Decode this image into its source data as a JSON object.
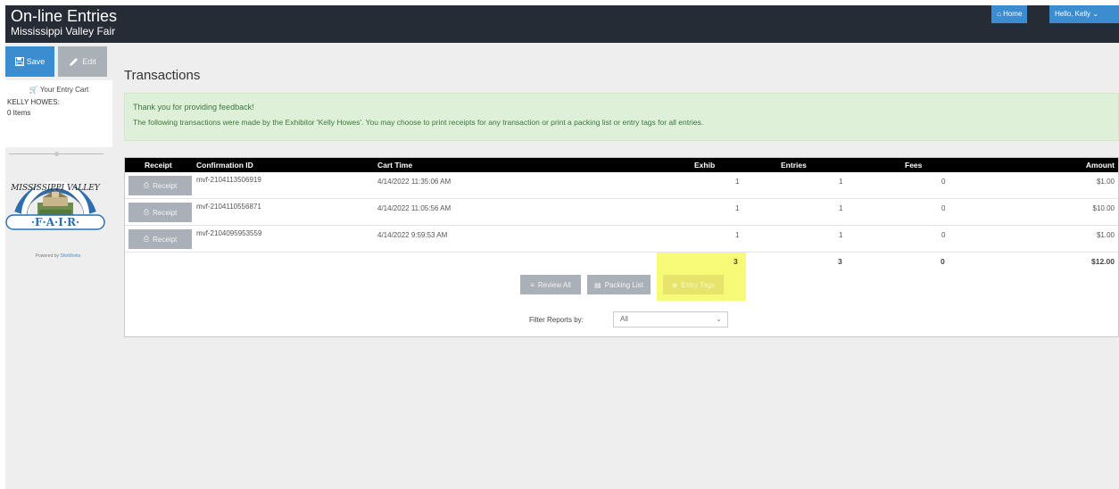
{
  "header": {
    "app_title": "On-line Entries",
    "subtitle": "Mississippi Valley Fair",
    "home_label": "Home",
    "user_label": "Hello, Kelly"
  },
  "sidebar": {
    "save_label": "Save",
    "edit_label": "Edit",
    "cart_title": "Your Entry Cart",
    "cart_user": "KELLY HOWES:",
    "cart_items": "0 Items",
    "logo_top": "MISSISSIPPI VALLEY",
    "logo_bottom": "F·A·I·R",
    "powered_prefix": "Powered by",
    "powered_link": "ShoWorks"
  },
  "main": {
    "title": "Transactions",
    "alert_heading": "Thank you for providing feedback!",
    "alert_text": "The following transactions were made by the Exhibitor 'Kelly Howes'. You may choose to print receipts for any transaction or print a packing list or entry tags for all entries.",
    "columns": [
      "Receipt",
      "Confirmation ID",
      "Cart Time",
      "Exhib",
      "Entries",
      "Fees",
      "Amount"
    ],
    "receipt_label": "Receipt",
    "rows": [
      {
        "id": "mvf-2104113506919",
        "time": "4/14/2022 11:35:06 AM",
        "exhib": "1",
        "entries": "1",
        "fees": "0",
        "amount": "$1.00"
      },
      {
        "id": "mvf-2104110556871",
        "time": "4/14/2022 11:05:56 AM",
        "exhib": "1",
        "entries": "1",
        "fees": "0",
        "amount": "$10.00"
      },
      {
        "id": "mvf-2104095953559",
        "time": "4/14/2022 9:59:53 AM",
        "exhib": "1",
        "entries": "1",
        "fees": "0",
        "amount": "$1.00"
      }
    ],
    "totals": {
      "exhib": "3",
      "entries": "3",
      "fees": "0",
      "amount": "$12.00"
    },
    "buttons": {
      "review_all": "Review All",
      "packing_list": "Packing List",
      "entry_tags": "Entry Tags"
    },
    "filter_label": "Filter Reports by:",
    "filter_value": "All"
  },
  "colors": {
    "topbar": "#252c35",
    "primary": "#3c8dd0",
    "alert_bg": "#dff0d8",
    "highlight": "#f6fa76",
    "button_gray": "#aab0b7"
  }
}
